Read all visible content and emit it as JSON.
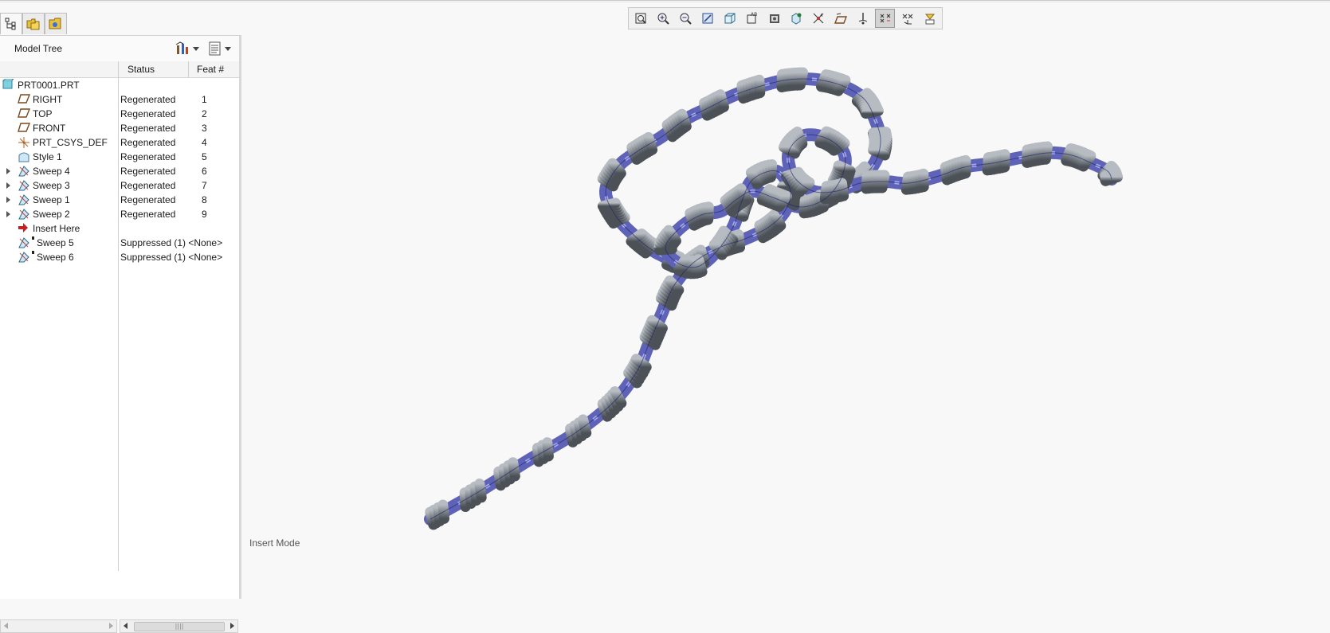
{
  "navigator": {
    "tabs": [
      "model-tree-tab",
      "folder-browser-tab",
      "favorites-tab"
    ]
  },
  "model_tree": {
    "title": "Model Tree",
    "columns": {
      "status": "Status",
      "feat": "Feat #"
    },
    "rows": [
      {
        "name": "PRT0001.PRT",
        "status": "",
        "feat": "",
        "icon": "part-icon",
        "expandable": false
      },
      {
        "name": "RIGHT",
        "status": "Regenerated",
        "feat": "1",
        "icon": "datum-plane-icon",
        "expandable": false
      },
      {
        "name": "TOP",
        "status": "Regenerated",
        "feat": "2",
        "icon": "datum-plane-icon",
        "expandable": false
      },
      {
        "name": "FRONT",
        "status": "Regenerated",
        "feat": "3",
        "icon": "datum-plane-icon",
        "expandable": false
      },
      {
        "name": "PRT_CSYS_DEF",
        "status": "Regenerated",
        "feat": "4",
        "icon": "csys-icon",
        "expandable": false
      },
      {
        "name": "Style 1",
        "status": "Regenerated",
        "feat": "5",
        "icon": "style-icon",
        "expandable": false
      },
      {
        "name": "Sweep 4",
        "status": "Regenerated",
        "feat": "6",
        "icon": "sweep-icon",
        "expandable": true
      },
      {
        "name": "Sweep 3",
        "status": "Regenerated",
        "feat": "7",
        "icon": "sweep-icon",
        "expandable": true
      },
      {
        "name": "Sweep 1",
        "status": "Regenerated",
        "feat": "8",
        "icon": "sweep-icon",
        "expandable": true
      },
      {
        "name": "Sweep 2",
        "status": "Regenerated",
        "feat": "9",
        "icon": "sweep-icon",
        "expandable": true
      },
      {
        "name": "Insert Here",
        "status": "",
        "feat": "",
        "icon": "insert-arrow-icon",
        "expandable": false
      },
      {
        "name": "Sweep 5",
        "status": "Suppressed (1) <None>",
        "feat": "",
        "icon": "sweep-icon",
        "expandable": false,
        "suppressed": true
      },
      {
        "name": "Sweep 6",
        "status": "Suppressed (1) <None>",
        "feat": "",
        "icon": "sweep-icon",
        "expandable": false,
        "suppressed": true
      }
    ]
  },
  "toolbar": {
    "buttons": [
      "refit-icon",
      "zoom-in-icon",
      "zoom-out-icon",
      "repaint-icon",
      "shading-icon",
      "annotation-display-icon",
      "saved-views-icon",
      "view-manager-icon",
      "spin-center-icon",
      "datum-plane-display-icon",
      "datum-axis-display-icon",
      "point-display-icon",
      "csys-display-icon",
      "orient-icon"
    ],
    "active": "point-display-icon"
  },
  "status": {
    "mode": "Insert Mode"
  },
  "colors": {
    "rope": "#7e848b",
    "rope_dark": "#575c62",
    "ribbon": "#5f63b8",
    "ribbon_light": "#a8acf0"
  }
}
